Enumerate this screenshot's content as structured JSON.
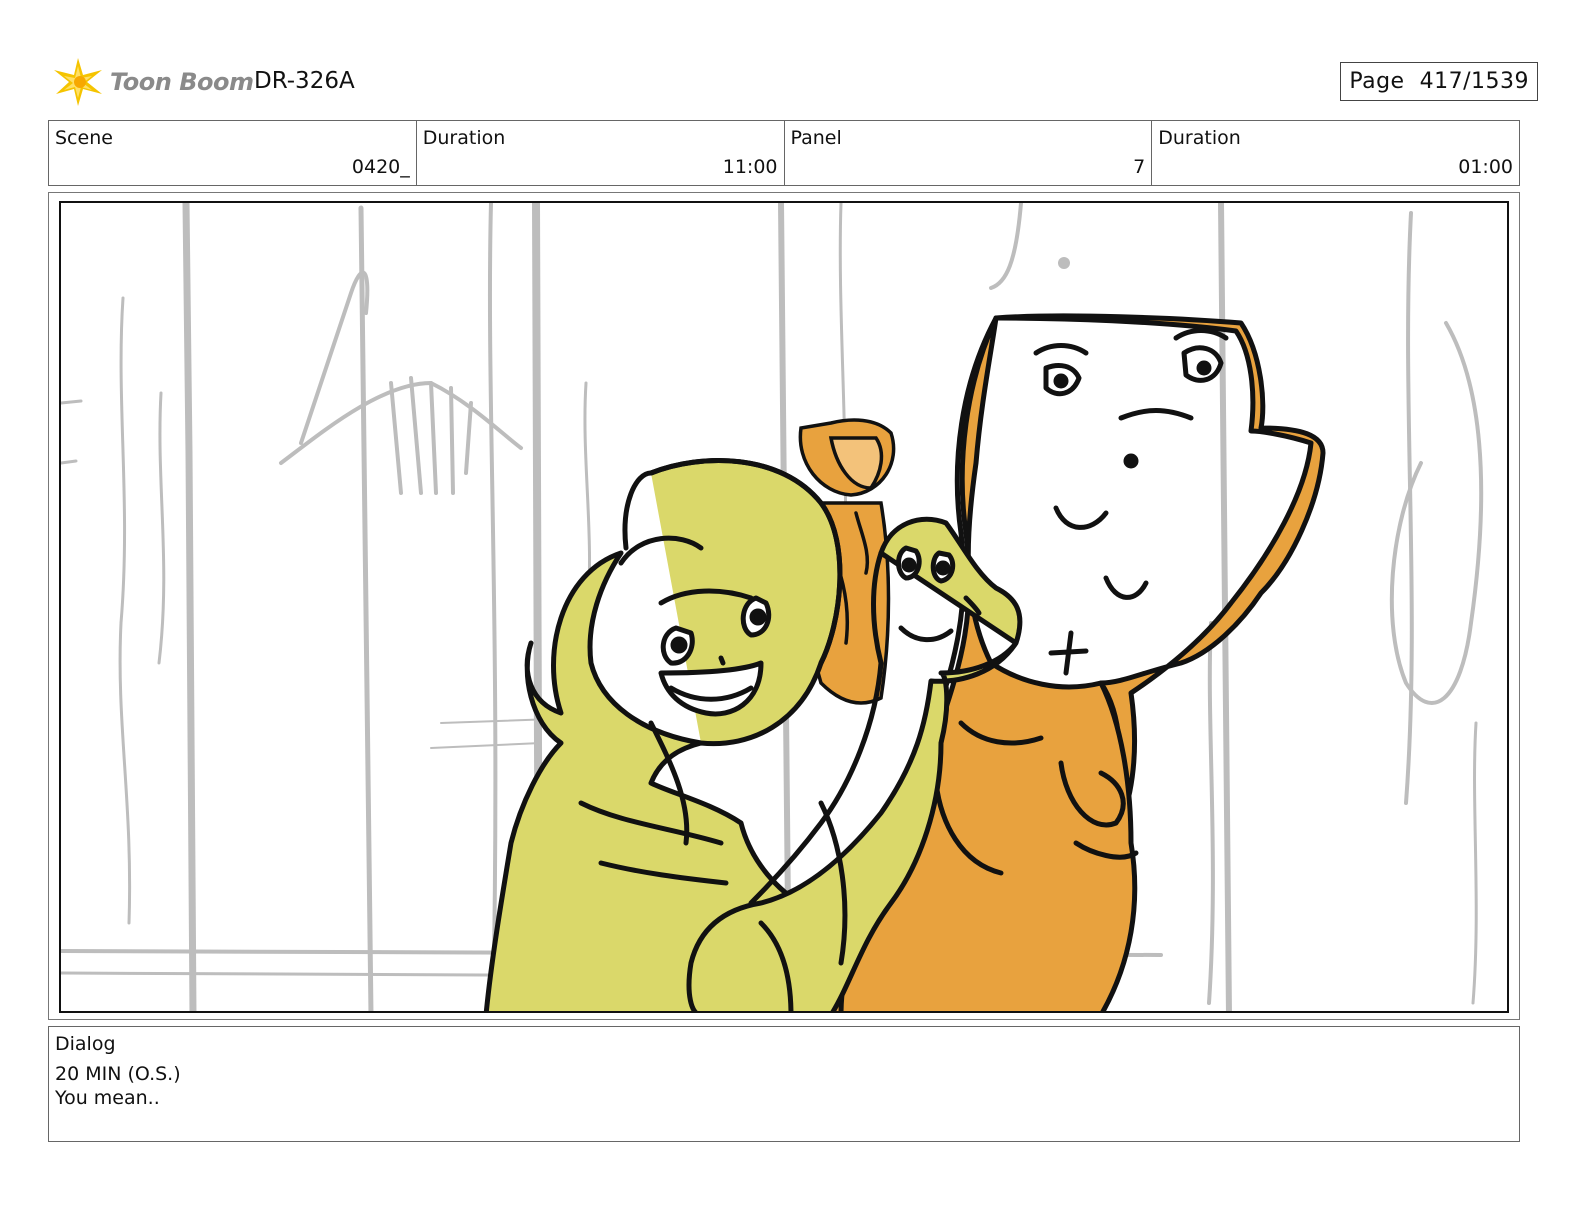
{
  "header": {
    "logo_text": "Toon Boom",
    "project_id": "DR-326A",
    "page_label": "Page",
    "page_value": "417/1539"
  },
  "info": {
    "scene_label": "Scene",
    "scene_value": "0420_",
    "scene_duration_label": "Duration",
    "scene_duration_value": "11:00",
    "panel_label": "Panel",
    "panel_value": "7",
    "panel_duration_label": "Duration",
    "panel_duration_value": "01:00"
  },
  "dialog": {
    "label": "Dialog",
    "speaker": "20 MIN (O.S.)",
    "line": "You mean.."
  },
  "colors": {
    "orange_character": "#E8A23E",
    "yellow_character": "#DAD86A",
    "sketch_gray": "#BDBDBD",
    "logo_star": "#F5C400"
  },
  "icons": {
    "logo": "toon-boom-star-icon"
  }
}
